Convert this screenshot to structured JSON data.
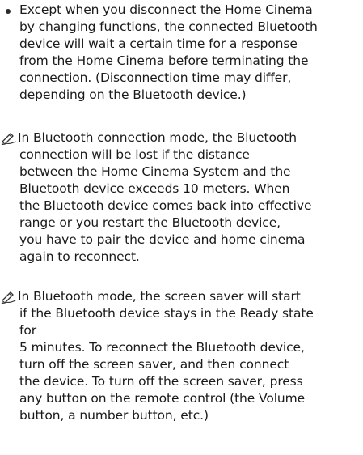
{
  "items": [
    {
      "type": "bullet",
      "icon": "bullet-dot",
      "text": "Except when you disconnect the Home Cinema\nby changing functions, the connected Bluetooth\ndevice will wait a certain time for a response\nfrom the Home Cinema before terminating the\nconnection. (Disconnection time may differ,\ndepending on the Bluetooth device.)"
    },
    {
      "type": "note",
      "icon": "note-pencil-icon",
      "first_line": "In Bluetooth connection mode, the Bluetooth",
      "rest": "connection will be lost if the distance\nbetween the Home Cinema System and the\nBluetooth device exceeds 10 meters. When\nthe Bluetooth device comes back into effective\nrange or you restart the Bluetooth device,\nyou have to pair the device and home cinema\nagain to reconnect."
    },
    {
      "type": "note",
      "icon": "note-pencil-icon",
      "first_line": "In Bluetooth mode, the screen saver will start",
      "rest": "if the Bluetooth device stays in the Ready state\nfor\n5 minutes. To reconnect the Bluetooth device,\nturn off the screen saver, and then connect\nthe device. To turn off the screen saver, press\nany button on the remote control (the Volume\nbutton, a number button, etc.)"
    }
  ]
}
